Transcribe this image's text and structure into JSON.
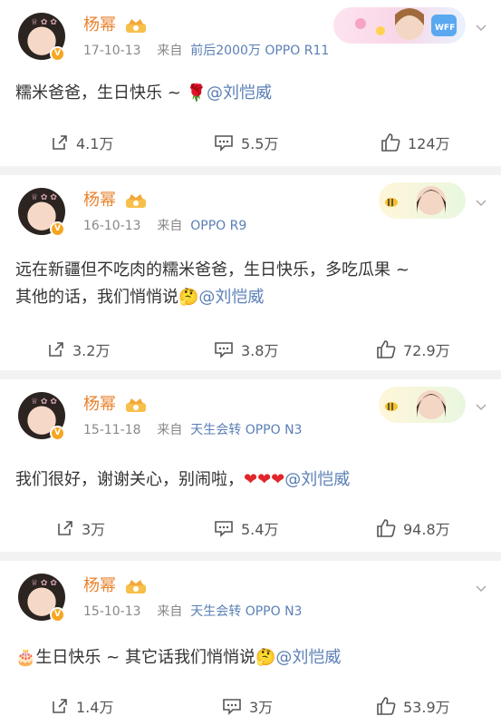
{
  "posts": [
    {
      "username": "杨幂",
      "date": "17-10-13",
      "from_label": "来自",
      "source": "前后2000万 OPPO R11",
      "text": "糯米爸爸，生日快乐 ~ ",
      "text2": "",
      "emoji": "rose-icon",
      "mention": "@刘恺威",
      "repost": "4.1万",
      "comment": "5.5万",
      "like": "124万"
    },
    {
      "username": "杨幂",
      "date": "16-10-13",
      "from_label": "来自",
      "source": "OPPO R9",
      "text": "远在新疆但不吃肉的糯米爸爸，生日快乐，多吃瓜果 ~",
      "text2": "其他的话，我们悄悄说",
      "emoji": "thinking-face-icon",
      "mention": "@刘恺威",
      "repost": "3.2万",
      "comment": "3.8万",
      "like": "72.9万"
    },
    {
      "username": "杨幂",
      "date": "15-11-18",
      "from_label": "来自",
      "source": "天生会转 OPPO N3",
      "text": "我们很好，谢谢关心，别闹啦，",
      "text2": "",
      "emoji": "hearts-icon",
      "mention": "@刘恺威",
      "repost": "3万",
      "comment": "5.4万",
      "like": "94.8万"
    },
    {
      "username": "杨幂",
      "date": "15-10-13",
      "from_label": "来自",
      "source": "天生会转 OPPO N3",
      "text": "生日快乐 ~ 其它话我们悄悄说",
      "text2": "",
      "emoji": "thinking-face-icon",
      "mention": "@刘恺威",
      "repost": "1.4万",
      "comment": "3万",
      "like": "53.9万"
    }
  ],
  "colors": {
    "username": "#e8822e",
    "link": "#5a7fb5",
    "meta": "#888888",
    "background": "#f2f2f2"
  }
}
